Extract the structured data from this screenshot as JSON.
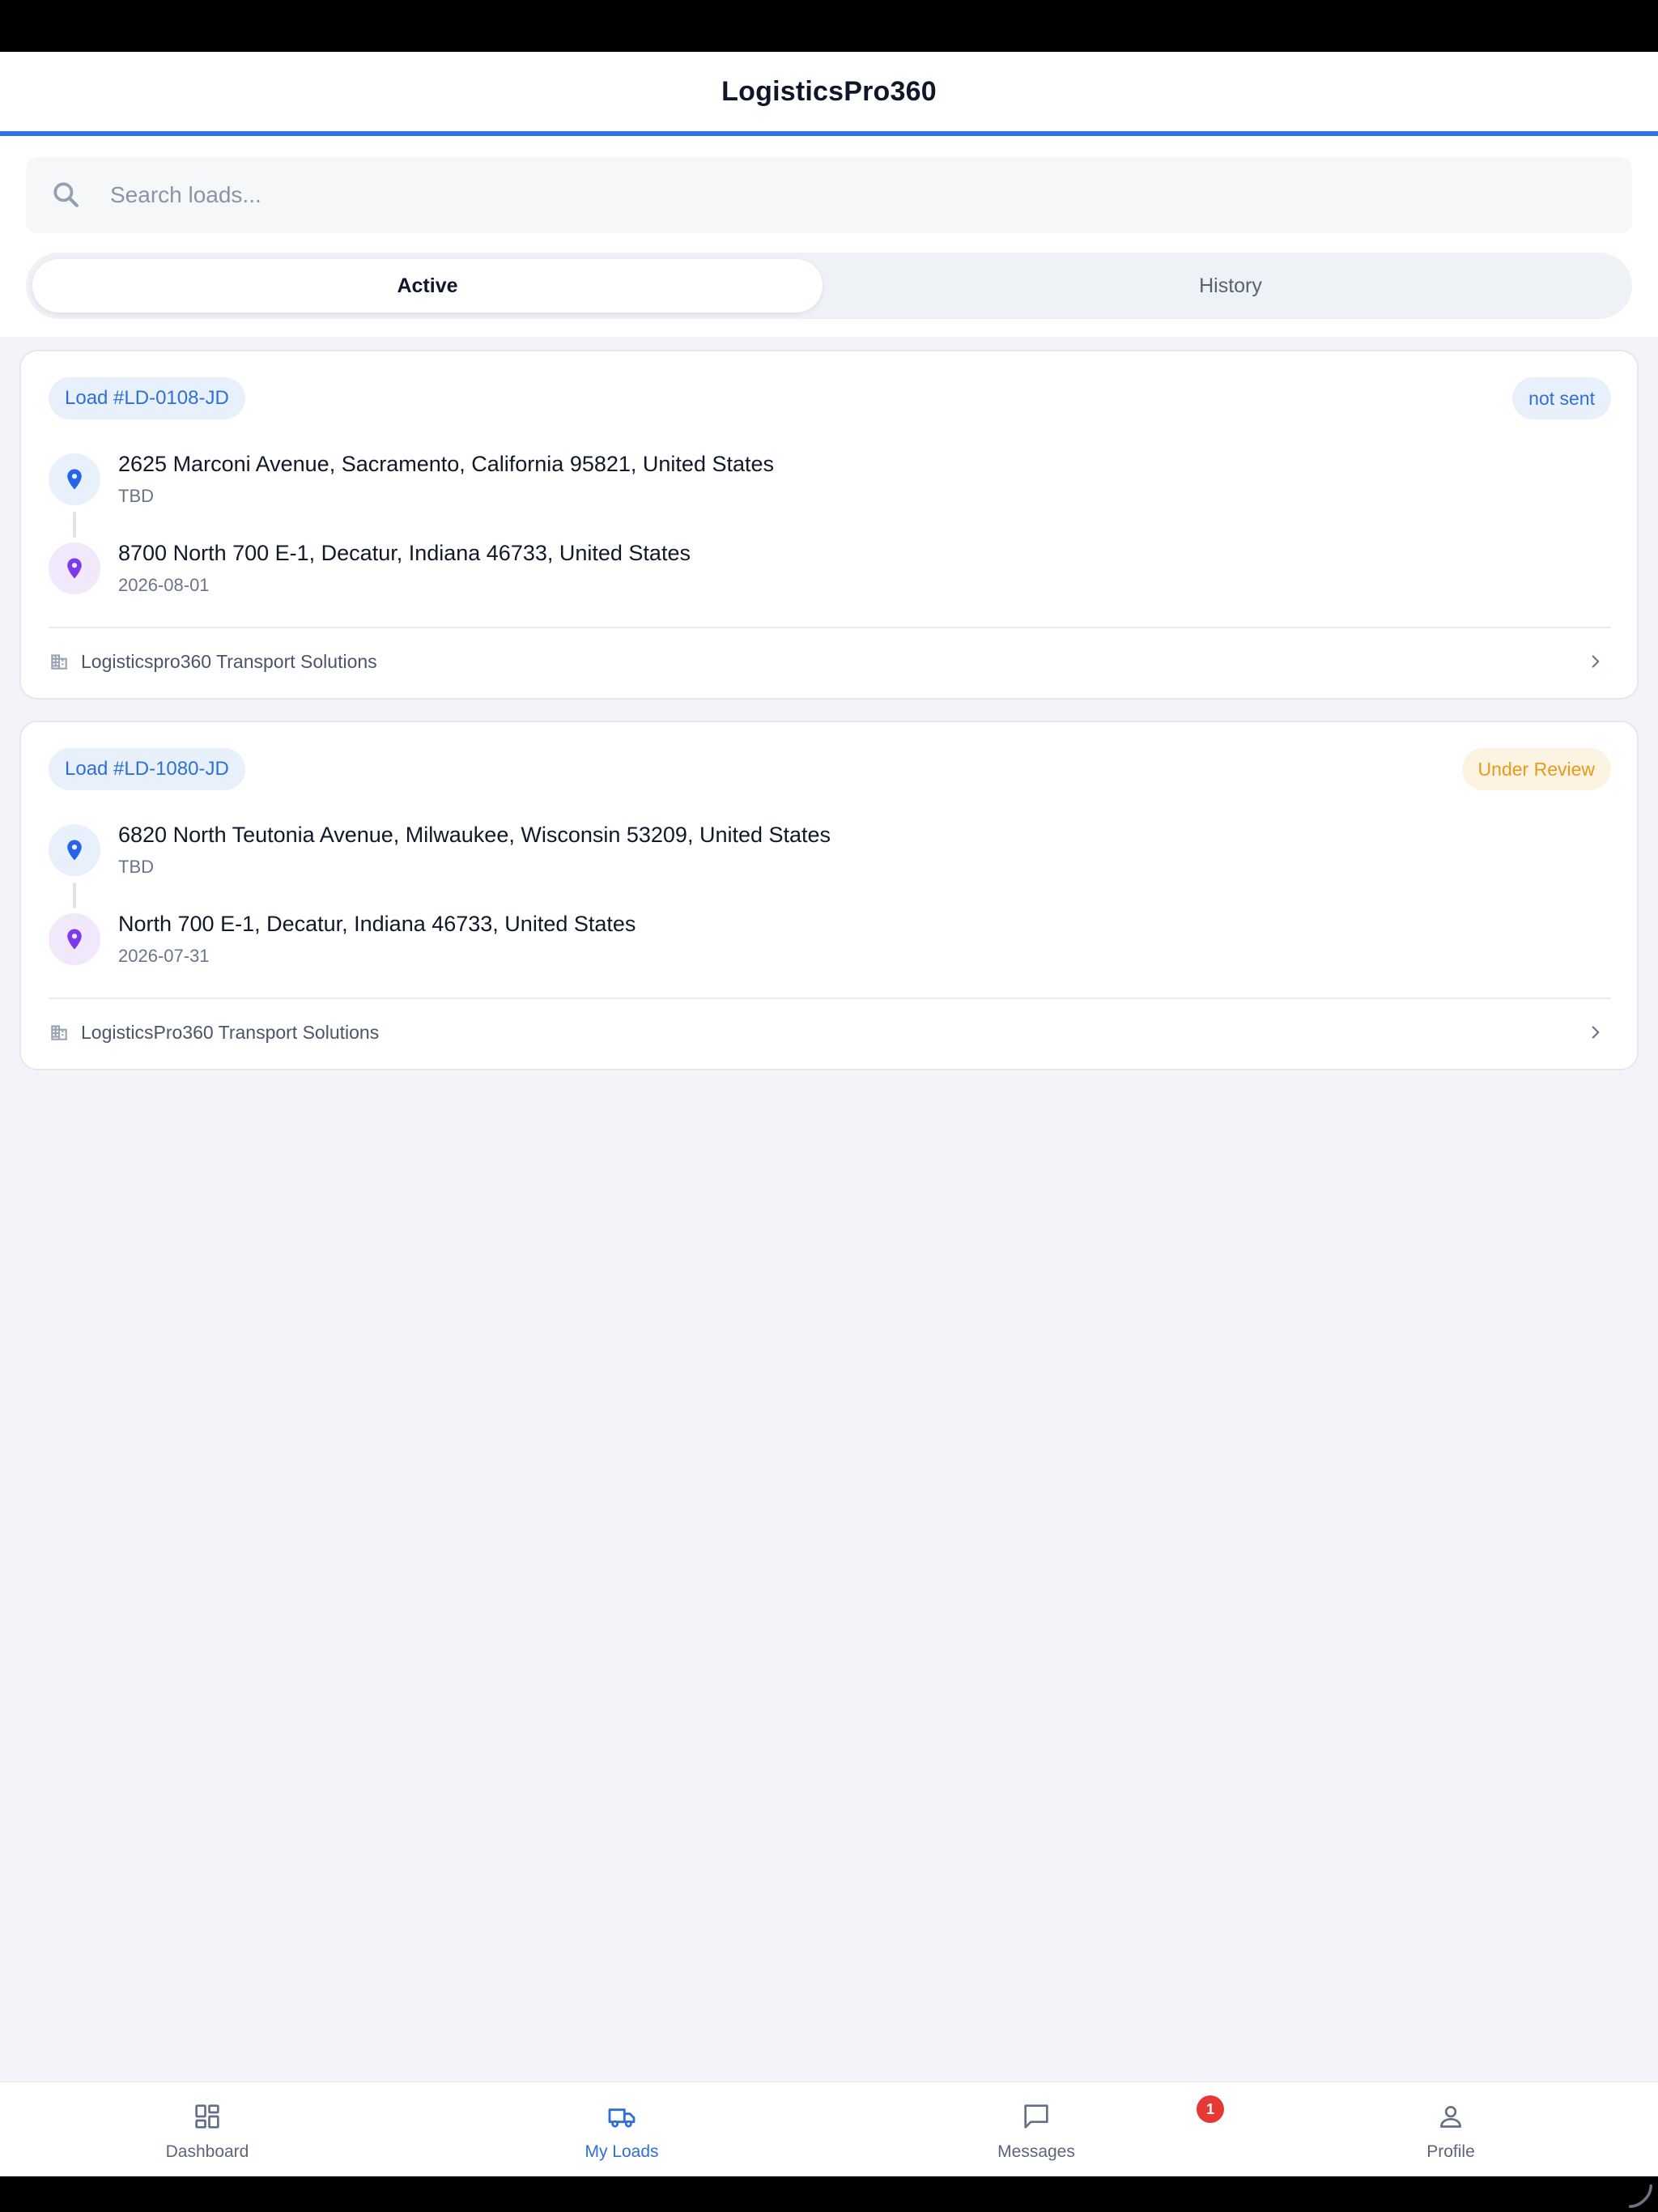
{
  "app": {
    "title": "LogisticsPro360"
  },
  "search": {
    "placeholder": "Search loads...",
    "value": ""
  },
  "segments": {
    "active_label": "Active",
    "history_label": "History"
  },
  "loads": [
    {
      "id_label": "Load #LD-0108-JD",
      "status": "not sent",
      "status_color": "#2f6fd6",
      "pickup": {
        "address": "2625 Marconi Avenue, Sacramento, California 95821, United States",
        "date": "TBD"
      },
      "dropoff": {
        "address": "8700 North 700 E-1, Decatur, Indiana 46733, United States",
        "date": "2026-08-01"
      },
      "company": "Logisticspro360 Transport Solutions"
    },
    {
      "id_label": "Load #LD-1080-JD",
      "status": "Under Review",
      "status_color": "#e69a1a",
      "pickup": {
        "address": "6820 North Teutonia Avenue, Milwaukee, Wisconsin 53209, United States",
        "date": "TBD"
      },
      "dropoff": {
        "address": "North 700 E-1, Decatur, Indiana 46733, United States",
        "date": "2026-07-31"
      },
      "company": "LogisticsPro360 Transport Solutions"
    }
  ],
  "tabbar": {
    "items": [
      {
        "label": "Dashboard",
        "icon": "dashboard-icon"
      },
      {
        "label": "My Loads",
        "icon": "truck-icon",
        "active": true
      },
      {
        "label": "Messages",
        "icon": "message-icon",
        "badge": "1"
      },
      {
        "label": "Profile",
        "icon": "person-icon"
      }
    ]
  },
  "colors": {
    "accent": "#2f73e0",
    "pin_blue": "#2563eb",
    "pin_purple": "#7c3aed",
    "badge": "#e53935"
  }
}
